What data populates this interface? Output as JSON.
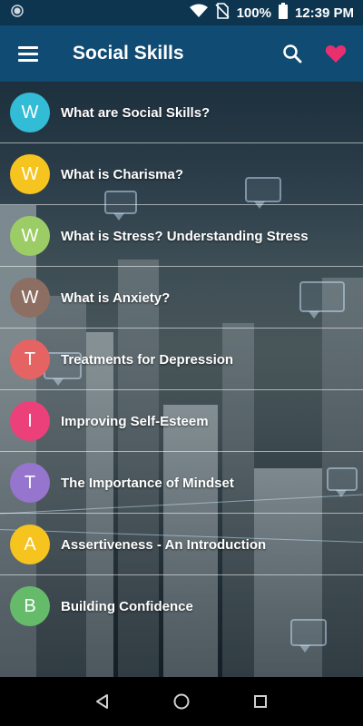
{
  "status_bar": {
    "battery": "100%",
    "time": "12:39",
    "period": "PM",
    "icons": [
      "notification-dot-icon",
      "wifi-icon",
      "no-sim-icon",
      "battery-icon"
    ]
  },
  "app_bar": {
    "title": "Social Skills",
    "menu_icon": "hamburger-menu-icon",
    "search_icon": "search-icon",
    "favorite_icon": "heart-icon",
    "colors": {
      "bar": "#0f4b73",
      "status": "#0d3550",
      "heart": "#e8306e"
    }
  },
  "items": [
    {
      "letter": "W",
      "title": "What are Social Skills?",
      "color": "#33bcd6"
    },
    {
      "letter": "W",
      "title": "What is Charisma?",
      "color": "#f5c41f"
    },
    {
      "letter": "W",
      "title": "What is Stress? Understanding Stress",
      "color": "#9ccc65"
    },
    {
      "letter": "W",
      "title": "What is Anxiety?",
      "color": "#8d6e63"
    },
    {
      "letter": "T",
      "title": "Treatments for Depression",
      "color": "#e66363"
    },
    {
      "letter": "I",
      "title": "Improving Self-Esteem",
      "color": "#ec407a"
    },
    {
      "letter": "T",
      "title": "The Importance of Mindset",
      "color": "#9575cd"
    },
    {
      "letter": "A",
      "title": "Assertiveness - An Introduction",
      "color": "#f5c41f"
    },
    {
      "letter": "B",
      "title": "Building Confidence",
      "color": "#66bb6a"
    }
  ],
  "nav_bar": {
    "icons": [
      "back-icon",
      "home-icon",
      "recents-icon"
    ]
  }
}
